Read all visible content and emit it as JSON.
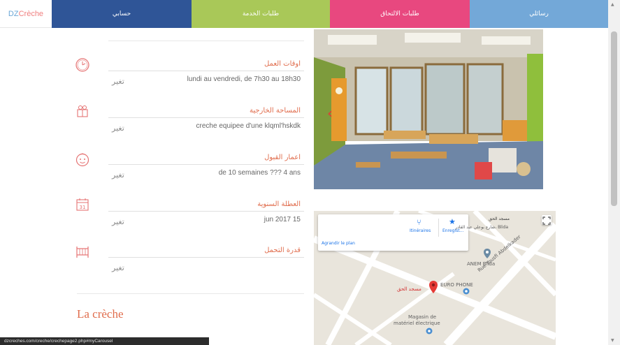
{
  "brand": {
    "part1": "DZ ",
    "part2": "Crèche"
  },
  "nav": {
    "item1": "حسابي",
    "item2": "طلبات الخدمة",
    "item3": "طلبات الالتحاق",
    "item4": "رسائلي"
  },
  "info": [
    {
      "icon": "clock-icon",
      "title": "اوقات العمل",
      "value": "lundi au vendredi, de 7h30 au 18h30",
      "change": "تغير"
    },
    {
      "icon": "toy-blocks-icon",
      "title": "المساحة الخارجية",
      "value": "creche equipee d'une klqml'hskdk",
      "change": "تغير"
    },
    {
      "icon": "baby-face-icon",
      "title": "اعمار القبول",
      "value": "de 10 semaines ??? 4 ans",
      "change": "تغير"
    },
    {
      "icon": "calendar-icon",
      "title": "العطلة السنوية",
      "value": "jun 2017 15",
      "change": "تغير",
      "calendar_day": "31"
    },
    {
      "icon": "crib-icon",
      "title": "قدرة التحمل",
      "value": "",
      "change": "تغير"
    }
  ],
  "section": {
    "title": "La crèche"
  },
  "map": {
    "card": {
      "name": "مسجد الحق",
      "address": "شارع بوعلي عبد القادر، Blida",
      "enlarge": "Agrandir le plan",
      "directions": "Itinéraires",
      "save": "Enregist..."
    },
    "labels": {
      "anem": "ANEM Blida",
      "street": "Rue Yousfi Abdelkader",
      "euro": "EURO PHONE",
      "mosque": "مسجد الحق",
      "magasin1": "Magasin de",
      "magasin2": "matériel électrique"
    }
  },
  "status": {
    "url": "dzcreches.com/creche/crechepage2.php#myCarousel"
  },
  "colors": {
    "nav1": "#2f5597",
    "nav2": "#a9c858",
    "nav3": "#e8487f",
    "nav4": "#73a8d8",
    "accent": "#e06c4c"
  }
}
